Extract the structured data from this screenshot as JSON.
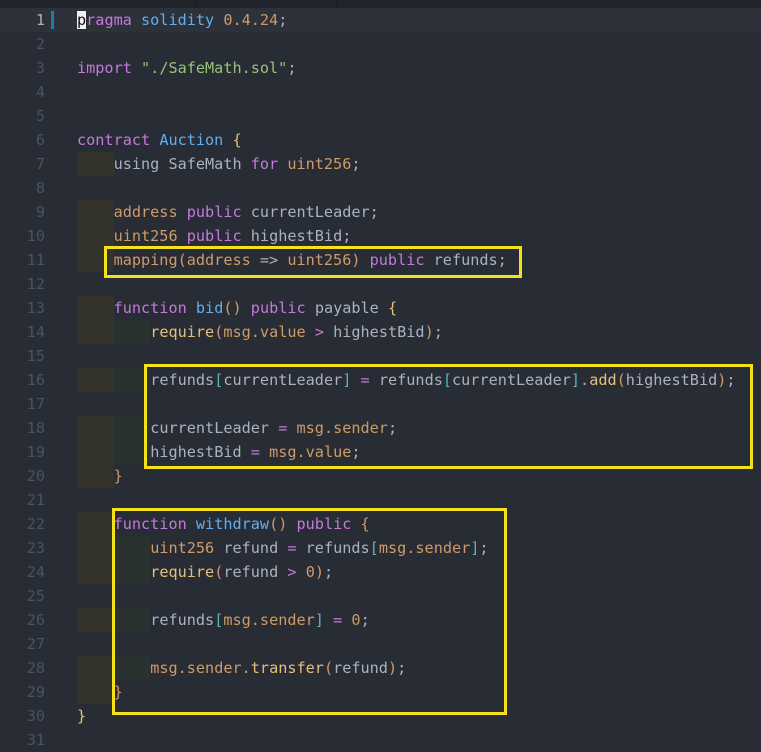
{
  "editor": {
    "current_line": 1,
    "lines": [
      {
        "n": "1",
        "indent": 0,
        "tokens": [
          [
            "p",
            "cursor"
          ],
          [
            "ragma",
            "k"
          ],
          [
            " ",
            "t"
          ],
          [
            "solidity",
            "f"
          ],
          [
            " ",
            "t"
          ],
          [
            "0.4.24",
            "n"
          ],
          [
            ";",
            "t"
          ]
        ]
      },
      {
        "n": "2",
        "indent": 0,
        "tokens": []
      },
      {
        "n": "3",
        "indent": 0,
        "tokens": [
          [
            "import",
            "k"
          ],
          [
            " ",
            "t"
          ],
          [
            "\"./SafeMath.sol\"",
            "s"
          ],
          [
            ";",
            "t"
          ]
        ]
      },
      {
        "n": "4",
        "indent": 0,
        "tokens": []
      },
      {
        "n": "5",
        "indent": 0,
        "tokens": []
      },
      {
        "n": "6",
        "indent": 0,
        "tokens": [
          [
            "contract",
            "k"
          ],
          [
            " ",
            "t"
          ],
          [
            "Auction",
            "f"
          ],
          [
            " ",
            "t"
          ],
          [
            "{",
            "y"
          ]
        ]
      },
      {
        "n": "7",
        "indent": 1,
        "tokens": [
          [
            "using SafeMath ",
            "t"
          ],
          [
            "for",
            "k"
          ],
          [
            " ",
            "t"
          ],
          [
            "uint256",
            "n"
          ],
          [
            ";",
            "t"
          ]
        ]
      },
      {
        "n": "8",
        "indent": 0,
        "tokens": []
      },
      {
        "n": "9",
        "indent": 1,
        "tokens": [
          [
            "address",
            "n"
          ],
          [
            " ",
            "t"
          ],
          [
            "public",
            "k"
          ],
          [
            " currentLeader;",
            "t"
          ]
        ]
      },
      {
        "n": "10",
        "indent": 1,
        "tokens": [
          [
            "uint256",
            "n"
          ],
          [
            " ",
            "t"
          ],
          [
            "public",
            "k"
          ],
          [
            " highestBid;",
            "t"
          ]
        ]
      },
      {
        "n": "11",
        "indent": 1,
        "tokens": [
          [
            "mapping(address",
            "n"
          ],
          [
            " => ",
            "t"
          ],
          [
            "uint256)",
            "n"
          ],
          [
            " ",
            "t"
          ],
          [
            "public",
            "k"
          ],
          [
            " refunds;",
            "t"
          ]
        ]
      },
      {
        "n": "12",
        "indent": 0,
        "tokens": []
      },
      {
        "n": "13",
        "indent": 1,
        "tokens": [
          [
            "function",
            "k"
          ],
          [
            " ",
            "t"
          ],
          [
            "bid",
            "f"
          ],
          [
            "()",
            "n"
          ],
          [
            " ",
            "t"
          ],
          [
            "public",
            "k"
          ],
          [
            " payable ",
            "t"
          ],
          [
            "{",
            "y"
          ]
        ]
      },
      {
        "n": "14",
        "indent": 2,
        "tokens": [
          [
            "require",
            "y"
          ],
          [
            "(",
            "n"
          ],
          [
            "msg.value",
            "n"
          ],
          [
            " ",
            "t"
          ],
          [
            ">",
            "k"
          ],
          [
            " highestBid",
            "t"
          ],
          [
            ")",
            "n"
          ],
          [
            ";",
            "t"
          ]
        ]
      },
      {
        "n": "15",
        "indent": 0,
        "tokens": []
      },
      {
        "n": "16",
        "indent": 2,
        "tokens": [
          [
            "refunds",
            "t"
          ],
          [
            "[",
            "b"
          ],
          [
            "currentLeader",
            "t"
          ],
          [
            "]",
            "b"
          ],
          [
            " ",
            "t"
          ],
          [
            "=",
            "k"
          ],
          [
            " refunds",
            "t"
          ],
          [
            "[",
            "b"
          ],
          [
            "currentLeader",
            "t"
          ],
          [
            "]",
            "b"
          ],
          [
            ".",
            "t"
          ],
          [
            "add",
            "y"
          ],
          [
            "(",
            "n"
          ],
          [
            "highestBid",
            "t"
          ],
          [
            ")",
            "n"
          ],
          [
            ";",
            "t"
          ]
        ]
      },
      {
        "n": "17",
        "indent": 0,
        "tokens": []
      },
      {
        "n": "18",
        "indent": 2,
        "tokens": [
          [
            "currentLeader ",
            "t"
          ],
          [
            "=",
            "k"
          ],
          [
            " ",
            "t"
          ],
          [
            "msg.sender",
            "n"
          ],
          [
            ";",
            "t"
          ]
        ]
      },
      {
        "n": "19",
        "indent": 2,
        "tokens": [
          [
            "highestBid ",
            "t"
          ],
          [
            "=",
            "k"
          ],
          [
            " ",
            "t"
          ],
          [
            "msg.value",
            "n"
          ],
          [
            ";",
            "t"
          ]
        ]
      },
      {
        "n": "20",
        "indent": 1,
        "tokens": [
          [
            "}",
            "n"
          ]
        ]
      },
      {
        "n": "21",
        "indent": 0,
        "tokens": []
      },
      {
        "n": "22",
        "indent": 1,
        "tokens": [
          [
            "function",
            "k"
          ],
          [
            " ",
            "t"
          ],
          [
            "withdraw",
            "f"
          ],
          [
            "()",
            "n"
          ],
          [
            " ",
            "t"
          ],
          [
            "public",
            "k"
          ],
          [
            " ",
            "t"
          ],
          [
            "{",
            "n"
          ]
        ]
      },
      {
        "n": "23",
        "indent": 2,
        "tokens": [
          [
            "uint256",
            "n"
          ],
          [
            " refund ",
            "t"
          ],
          [
            "=",
            "k"
          ],
          [
            " refunds",
            "t"
          ],
          [
            "[",
            "b"
          ],
          [
            "msg.sender",
            "n"
          ],
          [
            "]",
            "b"
          ],
          [
            ";",
            "t"
          ]
        ]
      },
      {
        "n": "24",
        "indent": 2,
        "tokens": [
          [
            "require",
            "y"
          ],
          [
            "(",
            "n"
          ],
          [
            "refund ",
            "t"
          ],
          [
            ">",
            "k"
          ],
          [
            " ",
            "t"
          ],
          [
            "0",
            "n"
          ],
          [
            ")",
            "n"
          ],
          [
            ";",
            "t"
          ]
        ]
      },
      {
        "n": "25",
        "indent": 0,
        "tokens": []
      },
      {
        "n": "26",
        "indent": 2,
        "tokens": [
          [
            "refunds",
            "t"
          ],
          [
            "[",
            "b"
          ],
          [
            "msg.sender",
            "n"
          ],
          [
            "]",
            "b"
          ],
          [
            " ",
            "t"
          ],
          [
            "=",
            "k"
          ],
          [
            " ",
            "t"
          ],
          [
            "0",
            "n"
          ],
          [
            ";",
            "t"
          ]
        ]
      },
      {
        "n": "27",
        "indent": 0,
        "tokens": []
      },
      {
        "n": "28",
        "indent": 2,
        "tokens": [
          [
            "msg.sender.",
            "n"
          ],
          [
            "transfer",
            "y"
          ],
          [
            "(",
            "n"
          ],
          [
            "refund",
            "t"
          ],
          [
            ")",
            "n"
          ],
          [
            ";",
            "t"
          ]
        ]
      },
      {
        "n": "29",
        "indent": 1,
        "tokens": [
          [
            "}",
            "n"
          ]
        ]
      },
      {
        "n": "30",
        "indent": 0,
        "tokens": [
          [
            "}",
            "y"
          ]
        ]
      },
      {
        "n": "31",
        "indent": 0,
        "tokens": []
      }
    ]
  },
  "highlights": [
    "line-11-mapping",
    "lines-16-19-bid-body",
    "lines-22-29-withdraw"
  ],
  "colors": {
    "highlight_border": "#f5e11b",
    "background": "#282c34"
  }
}
